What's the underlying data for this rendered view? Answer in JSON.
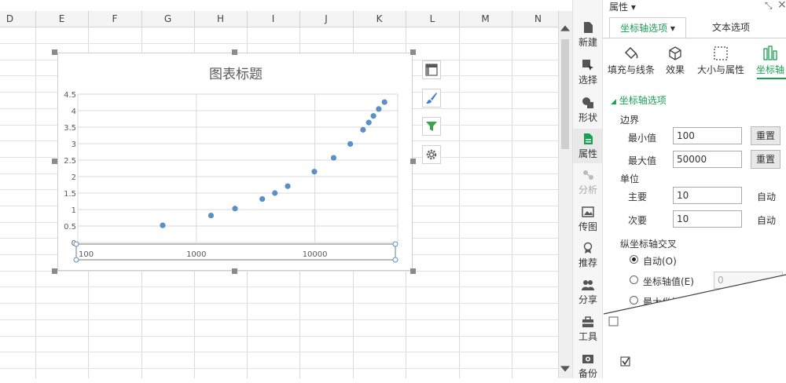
{
  "sheet": {
    "columns": [
      "D",
      "E",
      "F",
      "G",
      "H",
      "I",
      "J",
      "K",
      "L",
      "M",
      "N"
    ]
  },
  "chart_data": {
    "type": "scatter",
    "title": "图表标题",
    "x_scale": "log",
    "xlim": [
      100,
      50000
    ],
    "ylim": [
      0,
      4.5
    ],
    "x_tick_labels": [
      "100",
      "1000",
      "10000"
    ],
    "y_tick_labels": [
      "0",
      "0.5",
      "1",
      "1.5",
      "2",
      "2.5",
      "3",
      "3.5",
      "4",
      "4.5"
    ],
    "grid": true,
    "color": "#5b8fc5",
    "points": [
      {
        "x": 520,
        "y": 0.52
      },
      {
        "x": 1330,
        "y": 0.82
      },
      {
        "x": 2120,
        "y": 1.03
      },
      {
        "x": 3600,
        "y": 1.32
      },
      {
        "x": 4600,
        "y": 1.5
      },
      {
        "x": 5900,
        "y": 1.71
      },
      {
        "x": 9900,
        "y": 2.15
      },
      {
        "x": 14400,
        "y": 2.57
      },
      {
        "x": 19900,
        "y": 2.99
      },
      {
        "x": 25500,
        "y": 3.42
      },
      {
        "x": 28500,
        "y": 3.64
      },
      {
        "x": 31200,
        "y": 3.84
      },
      {
        "x": 34600,
        "y": 4.05
      },
      {
        "x": 38700,
        "y": 4.26
      }
    ]
  },
  "side_strip": {
    "items": [
      {
        "label": "新建",
        "icon": "new-icon"
      },
      {
        "label": "选择",
        "icon": "select-icon"
      },
      {
        "label": "形状",
        "icon": "shape-icon"
      },
      {
        "label": "属性",
        "icon": "property-icon"
      },
      {
        "label": "分析",
        "icon": "analysis-icon"
      },
      {
        "label": "传图",
        "icon": "upload-image-icon"
      },
      {
        "label": "推荐",
        "icon": "recommend-icon"
      },
      {
        "label": "分享",
        "icon": "share-icon"
      },
      {
        "label": "工具",
        "icon": "toolbox-icon"
      },
      {
        "label": "备份",
        "icon": "backup-icon"
      }
    ]
  },
  "panel": {
    "title": "属性 ▾",
    "tabs": {
      "axis": "坐标轴选项",
      "text": "文本选项"
    },
    "categories": [
      "填充与线条",
      "效果",
      "大小与属性",
      "坐标轴"
    ],
    "section": "坐标轴选项",
    "bounds": {
      "label": "边界",
      "min_label": "最小值",
      "min_value": "100",
      "max_label": "最大值",
      "max_value": "50000",
      "reset": "重置"
    },
    "units": {
      "label": "单位",
      "major_label": "主要",
      "major_value": "10",
      "minor_label": "次要",
      "minor_value": "10",
      "auto": "自动"
    },
    "cross": {
      "label": "纵坐标轴交叉",
      "auto": "自动(O)",
      "axis_value": "坐标轴值(E)",
      "axis_value_input": "0",
      "max": "最大坐标轴值(M)"
    }
  },
  "colors": {
    "accent": "#1aa053",
    "marker": "#5b8fc5"
  }
}
